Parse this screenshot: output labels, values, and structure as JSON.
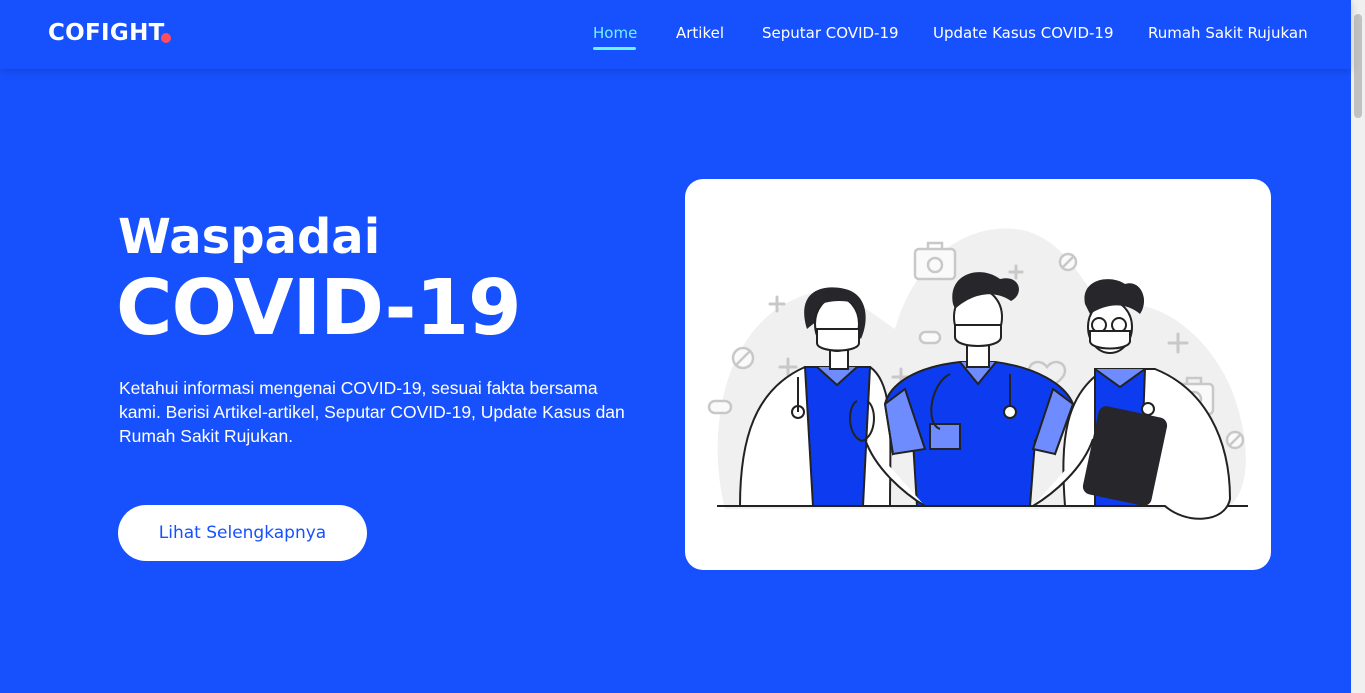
{
  "brand": {
    "name": "COFIGHT",
    "dot_color": "#ff4d5e"
  },
  "nav": {
    "items": [
      {
        "label": "Home",
        "active": true
      },
      {
        "label": "Artikel",
        "active": false
      },
      {
        "label": "Seputar COVID-19",
        "active": false
      },
      {
        "label": "Update Kasus COVID-19",
        "active": false
      },
      {
        "label": "Rumah Sakit Rujukan",
        "active": false
      }
    ]
  },
  "hero": {
    "kicker": "Waspadai",
    "title": "COVID-19",
    "description": "Ketahui informasi mengenai COVID-19, sesuai fakta bersama kami. Berisi Artikel-artikel, Seputar COVID-19, Update Kasus dan Rumah Sakit Rujukan.",
    "cta_label": "Lihat Selengkapnya"
  },
  "illustration": {
    "name": "medical-team-illustration"
  },
  "colors": {
    "background": "#1751fe",
    "accent": "#6ff3ff",
    "scrub_blue": "#0d3cf0",
    "white": "#ffffff"
  }
}
